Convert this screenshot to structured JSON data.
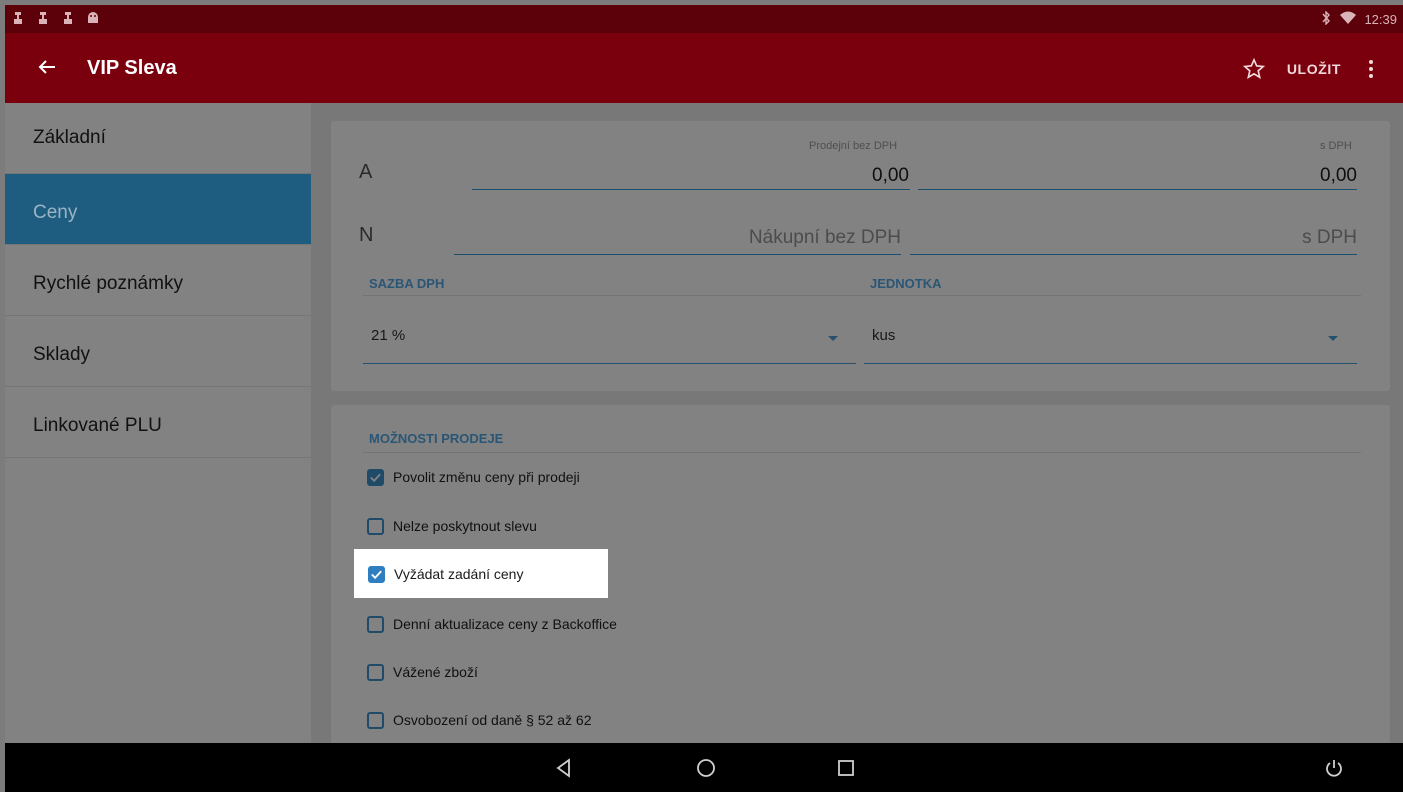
{
  "status": {
    "time": "12:39",
    "left_icons": [
      "notification-icon",
      "notification-icon",
      "notification-icon",
      "android-icon"
    ],
    "right_icons": [
      "bluetooth-icon",
      "wifi-icon"
    ]
  },
  "appbar": {
    "title": "VIP Sleva",
    "save_label": "ULOŽIT",
    "color": "#7a000e"
  },
  "sidebar": {
    "items": [
      {
        "label": "Základní",
        "active": false
      },
      {
        "label": "Ceny",
        "active": true
      },
      {
        "label": "Rychlé poznámky",
        "active": false
      },
      {
        "label": "Sklady",
        "active": false
      },
      {
        "label": "Linkované PLU",
        "active": false
      }
    ]
  },
  "prices": {
    "row_a": {
      "label": "A",
      "sell_no_vat_label": "Prodejní bez DPH",
      "sell_no_vat_value": "0,00",
      "with_vat_label": "s DPH",
      "with_vat_value": "0,00"
    },
    "row_n": {
      "label": "N",
      "buy_no_vat_placeholder": "Nákupní bez DPH",
      "with_vat_placeholder": "s DPH"
    },
    "vat": {
      "label": "SAZBA DPH",
      "value": "21 %"
    },
    "unit": {
      "label": "JEDNOTKA",
      "value": "kus"
    }
  },
  "options": {
    "title": "MOŽNOSTI PRODEJE",
    "items": [
      {
        "label": "Povolit změnu ceny při prodeji",
        "checked": true
      },
      {
        "label": "Nelze poskytnout slevu",
        "checked": false
      },
      {
        "label": "Vyžádat zadání ceny",
        "checked": true
      },
      {
        "label": "Denní aktualizace ceny z Backoffice",
        "checked": false
      },
      {
        "label": "Vážené zboží",
        "checked": false
      },
      {
        "label": "Osvobození od daně § 52 až 62",
        "checked": false
      }
    ]
  },
  "navbar": {
    "icons": [
      "back-triangle-icon",
      "home-circle-icon",
      "recents-square-icon",
      "power-icon"
    ]
  }
}
